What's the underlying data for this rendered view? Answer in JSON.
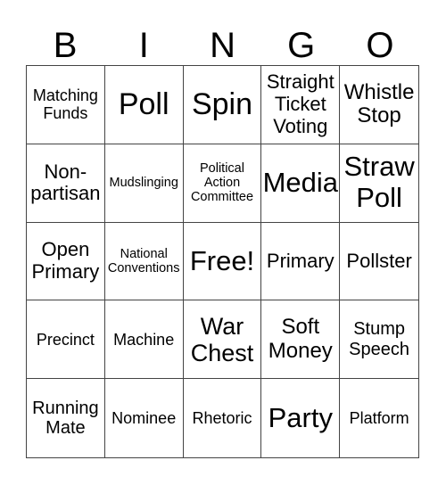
{
  "header": [
    "B",
    "I",
    "N",
    "G",
    "O"
  ],
  "cells": [
    "Matching Funds",
    "Poll",
    "Spin",
    "Straight Ticket Voting",
    "Whistle Stop",
    "Non-partisan",
    "Mudslinging",
    "Political Action Committee",
    "Media",
    "Straw Poll",
    "Open Primary",
    "National Conventions",
    "Free!",
    "Primary",
    "Pollster",
    "Precinct",
    "Machine",
    "War Chest",
    "Soft Money",
    "Stump Speech",
    "Running Mate",
    "Nominee",
    "Rhetoric",
    "Party",
    "Platform"
  ]
}
